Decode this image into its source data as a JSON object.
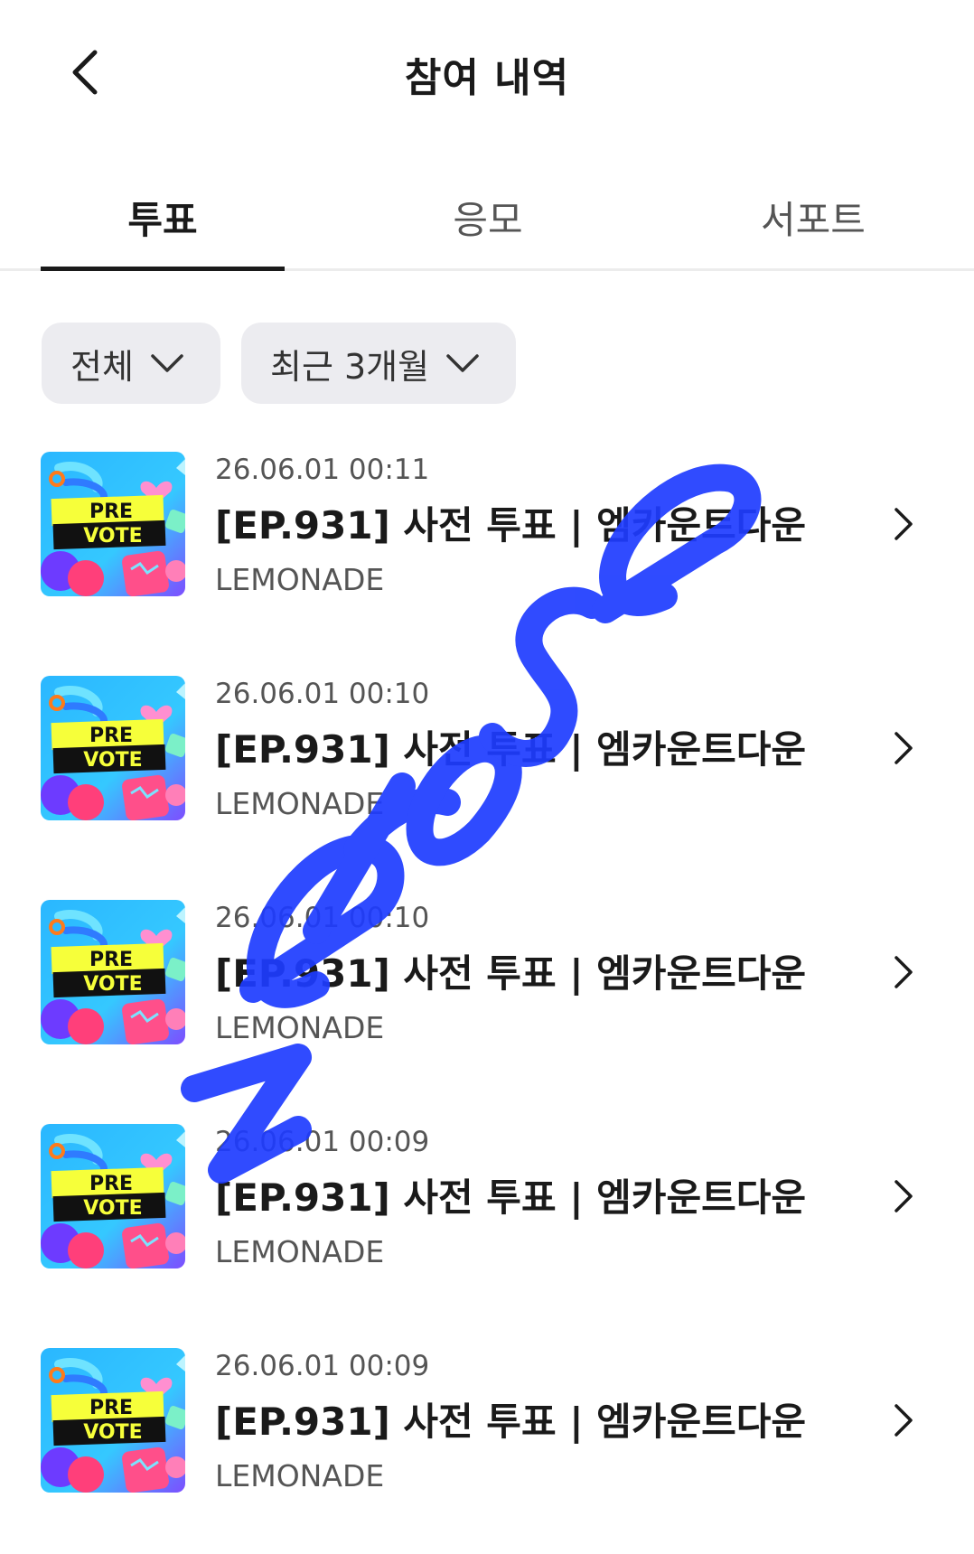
{
  "header": {
    "title": "참여 내역"
  },
  "tabs": [
    {
      "label": "투표",
      "active": true
    },
    {
      "label": "응모",
      "active": false
    },
    {
      "label": "서포트",
      "active": false
    }
  ],
  "filters": {
    "category": "전체",
    "period": "최근 3개월"
  },
  "items": [
    {
      "date": "26.06.01 00:11",
      "title": "[EP.931] 사전 투표 | 엠카운트다운",
      "org": "LEMONADE",
      "thumb_text_1": "PRE",
      "thumb_text_2": "VOTE"
    },
    {
      "date": "26.06.01 00:10",
      "title": "[EP.931] 사전 투표 | 엠카운트다운",
      "org": "LEMONADE",
      "thumb_text_1": "PRE",
      "thumb_text_2": "VOTE"
    },
    {
      "date": "26.06.01 00:10",
      "title": "[EP.931] 사전 투표 | 엠카운트다운",
      "org": "LEMONADE",
      "thumb_text_1": "PRE",
      "thumb_text_2": "VOTE"
    },
    {
      "date": "26.06.01 00:09",
      "title": "[EP.931] 사전 투표 | 엠카운트다운",
      "org": "LEMONADE",
      "thumb_text_1": "PRE",
      "thumb_text_2": "VOTE"
    },
    {
      "date": "26.06.01 00:09",
      "title": "[EP.931] 사전 투표 | 엠카운트다운",
      "org": "LEMONADE",
      "thumb_text_1": "PRE",
      "thumb_text_2": "VOTE"
    }
  ],
  "watermark": {
    "text": "zerose",
    "color": "#1e3cff"
  },
  "colors": {
    "text_primary": "#1a1a1a",
    "text_secondary": "#555555",
    "chip_bg": "#ececf0",
    "divider": "#ececec"
  }
}
